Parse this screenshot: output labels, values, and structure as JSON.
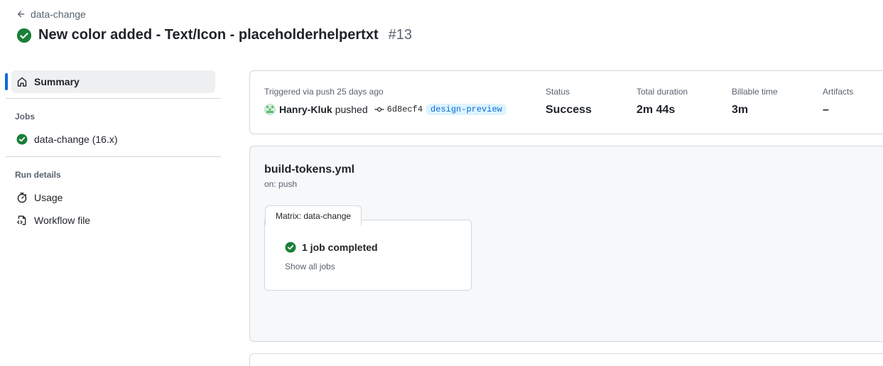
{
  "header": {
    "back_label": "data-change",
    "title": "New color added - Text/Icon - placeholderhelpertxt",
    "run_number": "#13",
    "status_color": "#1a7f37"
  },
  "sidebar": {
    "summary_label": "Summary",
    "jobs_heading": "Jobs",
    "jobs": [
      {
        "label": "data-change (16.x)",
        "status": "success"
      }
    ],
    "run_details_heading": "Run details",
    "run_details": [
      {
        "label": "Usage",
        "icon": "stopwatch-icon"
      },
      {
        "label": "Workflow file",
        "icon": "file-code-icon"
      }
    ]
  },
  "summary": {
    "trigger_label": "Triggered via push 25 days ago",
    "actor": "Hanry-Kluk",
    "action": "pushed",
    "commit_sha": "6d8ecf4",
    "branch": "design-preview",
    "stats": [
      {
        "label": "Status",
        "value": "Success"
      },
      {
        "label": "Total duration",
        "value": "2m 44s"
      },
      {
        "label": "Billable time",
        "value": "3m"
      },
      {
        "label": "Artifacts",
        "value": "–"
      }
    ]
  },
  "workflow": {
    "name": "build-tokens.yml",
    "trigger": "on: push",
    "matrix_label": "Matrix: data-change",
    "job_status": "1 job completed",
    "show_all": "Show all jobs"
  },
  "colors": {
    "accent": "#0969da",
    "success": "#1a7f37",
    "branch_bg": "#ddf4ff"
  }
}
